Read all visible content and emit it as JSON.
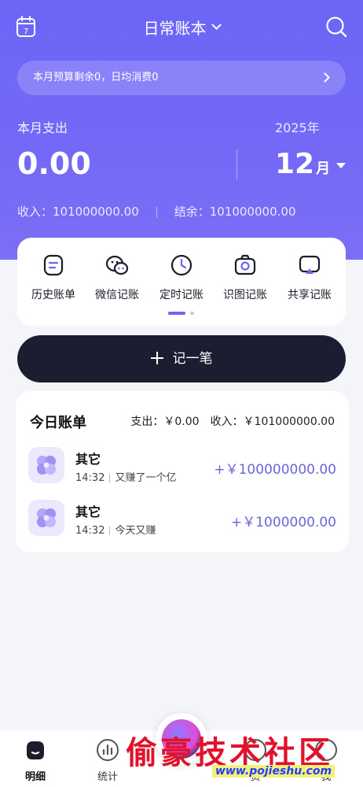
{
  "header": {
    "book_title": "日常账本",
    "calendar_day": "7"
  },
  "budget": {
    "text": "本月预算剩余0，日均消费0"
  },
  "summary": {
    "month_label": "本月支出",
    "year_label": "2025年",
    "amount": "0.00",
    "month_number": "12",
    "month_unit": "月",
    "income_text": "收入：101000000.00",
    "balance_text": "结余：101000000.00"
  },
  "quick_actions": [
    {
      "label": "历史账单",
      "icon": "history-bill-icon"
    },
    {
      "label": "微信记账",
      "icon": "wechat-icon"
    },
    {
      "label": "定时记账",
      "icon": "clock-icon"
    },
    {
      "label": "识图记账",
      "icon": "camera-icon"
    },
    {
      "label": "共享记账",
      "icon": "share-icon"
    }
  ],
  "add_button": {
    "label": "记一笔"
  },
  "today": {
    "title": "今日账单",
    "expense_text": "支出：￥0.00",
    "income_text": "收入：￥101000000.00",
    "records": [
      {
        "name": "其它",
        "time": "14:32",
        "note": "又赚了一个亿",
        "amount": "+￥100000000.00",
        "icon": "other-category-icon"
      },
      {
        "name": "其它",
        "time": "14:32",
        "note": "今天又赚",
        "amount": "+￥1000000.00",
        "icon": "other-category-icon"
      }
    ]
  },
  "tabs": [
    {
      "label": "明细",
      "icon": "detail-icon",
      "active": true
    },
    {
      "label": "统计",
      "icon": "stats-icon",
      "active": false
    },
    {
      "label": "资",
      "icon": "assets-icon",
      "active": false
    },
    {
      "label": "我",
      "icon": "profile-icon",
      "active": false
    }
  ],
  "watermark": {
    "text": "偷豪技术社区",
    "url": "www.pojieshu.com"
  },
  "colors": {
    "accent": "#6b66f6",
    "dark_button": "#1c1d30",
    "amount_text": "#6b65d8"
  }
}
